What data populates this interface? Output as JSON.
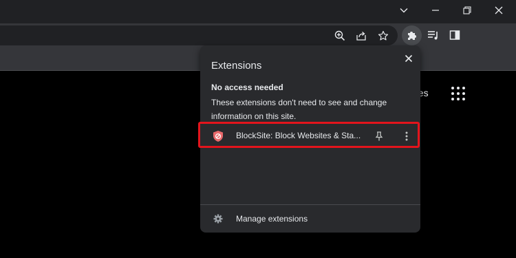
{
  "window_controls": {
    "dropdown_icon": "chevron-down-icon",
    "minimize_icon": "minimize-icon",
    "restore_icon": "restore-icon",
    "close_icon": "close-icon"
  },
  "toolbar": {
    "icons": [
      "zoom-icon",
      "share-icon",
      "star-icon",
      "extensions-puzzle-icon",
      "media-queue-icon",
      "side-panel-icon"
    ]
  },
  "page": {
    "partial_text": "ges"
  },
  "extensions_popup": {
    "title": "Extensions",
    "section_heading": "No access needed",
    "section_description": "These extensions don't need to see and change information on this site.",
    "items": [
      {
        "name": "BlockSite: Block Websites & Sta...",
        "icon": "blocksite-shield-icon",
        "accent": "#e8696b"
      }
    ],
    "manage_label": "Manage extensions"
  },
  "colors": {
    "highlight": "#e3141c",
    "popup_bg": "#292a2d",
    "toolbar_bg": "#35363a",
    "titlebar_bg": "#202124"
  }
}
